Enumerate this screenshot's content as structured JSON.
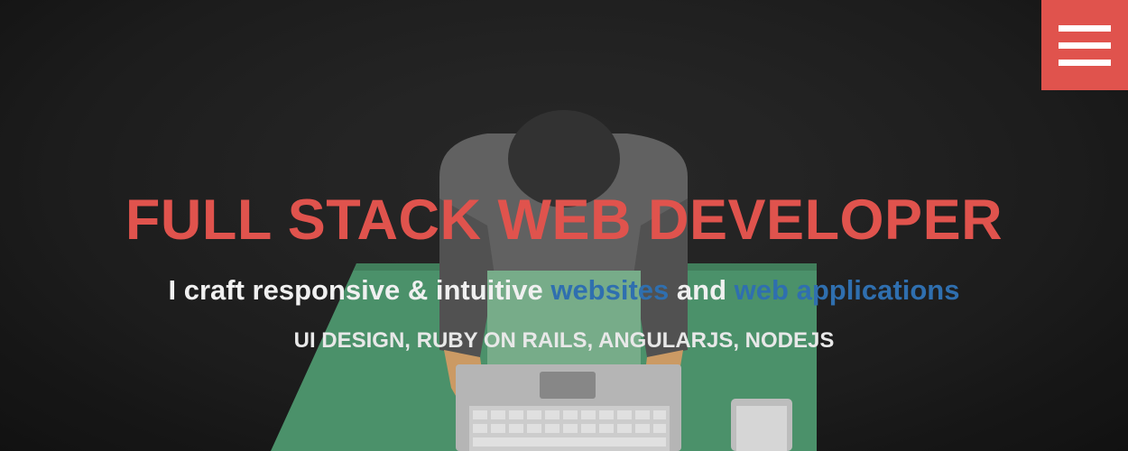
{
  "hero": {
    "headline": "FULL STACK WEB DEVELOPER",
    "tagline": {
      "intro": "I craft responsive & intuitive",
      "websites": "websites",
      "and": "and",
      "web": "web",
      "applications": "applications"
    },
    "skills": "UI DESIGN, RUBY ON RAILS, ANGULARJS, NODEJS"
  },
  "menu": {
    "icon": "hamburger-menu-icon"
  },
  "colors": {
    "accent_red": "#e0534d",
    "link_blue": "#2f6faf",
    "desk_green": "#56a579",
    "background": "#1f1f1f"
  }
}
